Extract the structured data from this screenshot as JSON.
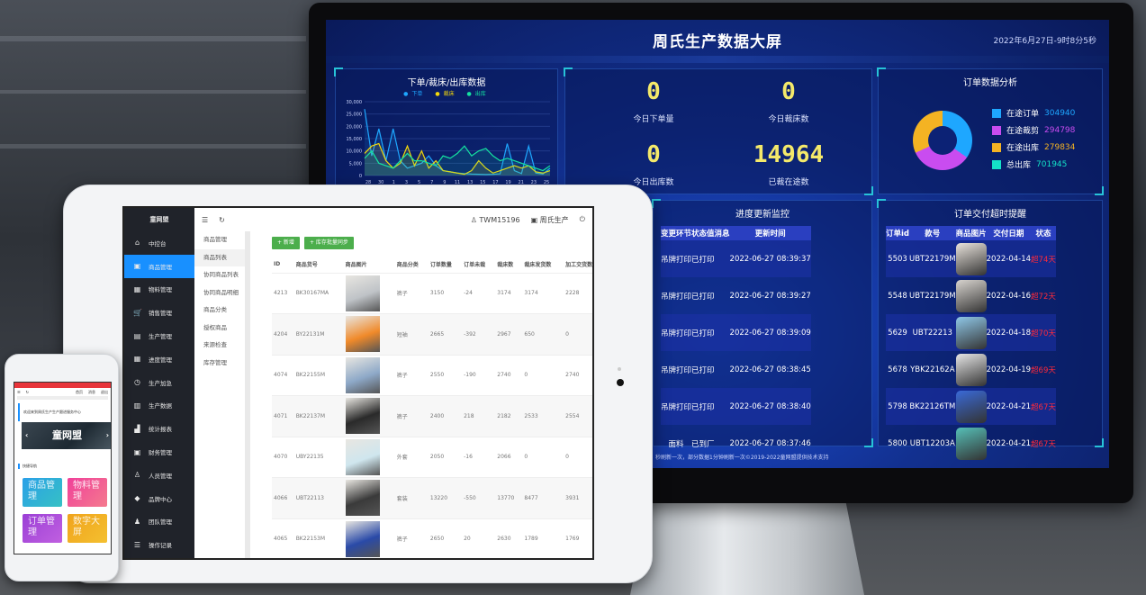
{
  "dashboard": {
    "title": "周氏生产数据大屏",
    "datetime": "2022年6月27日-9时8分5秒",
    "chart": {
      "title": "下单/裁床/出库数据",
      "legend": [
        "下单",
        "裁床",
        "出库"
      ],
      "colors": [
        "#1ea7ff",
        "#f5d90a",
        "#14e2a0"
      ],
      "y_ticks": [
        "30,000",
        "25,000",
        "20,000",
        "15,000",
        "10,000",
        "5,000",
        "0"
      ],
      "x_ticks": [
        "28",
        "30",
        "1",
        "3",
        "5",
        "7",
        "9",
        "11",
        "13",
        "15",
        "17",
        "19",
        "21",
        "23",
        "25"
      ],
      "series": [
        [
          27000,
          8000,
          19000,
          6000,
          19000,
          6000,
          3000,
          4000,
          5000,
          8000,
          4000,
          2000,
          1500,
          1000,
          800,
          600,
          500,
          400,
          500,
          700,
          13000,
          2000,
          800,
          12000,
          1000,
          600,
          3000
        ],
        [
          9000,
          12000,
          13000,
          6000,
          3000,
          5000,
          12000,
          4000,
          10000,
          3000,
          6000,
          2000,
          1500,
          1000,
          500,
          2000,
          6000,
          3000,
          1000,
          2000,
          3000,
          4000,
          3000,
          4000,
          1500,
          1000,
          2000
        ],
        [
          7000,
          10000,
          5000,
          4000,
          3000,
          6000,
          9000,
          6000,
          6000,
          5000,
          4000,
          8000,
          7000,
          9000,
          12000,
          8000,
          10000,
          11000,
          8000,
          6000,
          7000,
          6000,
          5000,
          4000,
          3000,
          2000,
          4000
        ]
      ]
    },
    "kpis": [
      {
        "value": "0",
        "label": "今日下单量"
      },
      {
        "value": "0",
        "label": "今日裁床数"
      },
      {
        "value": "0",
        "label": "今日出库数"
      },
      {
        "value": "14964",
        "label": "已裁在途数"
      }
    ],
    "order_analysis": {
      "title": "订单数据分析",
      "items": [
        {
          "label": "在途订单",
          "value": "304940",
          "color": "#1ea7ff"
        },
        {
          "label": "在途裁剪",
          "value": "294798",
          "color": "#c94cf0"
        },
        {
          "label": "在途出库",
          "value": "279834",
          "color": "#f4b323"
        },
        {
          "label": "总出库",
          "value": "701945",
          "color": "#14e2c8"
        }
      ]
    },
    "progress": {
      "title": "进度更新监控",
      "headers": [
        "变更环节",
        "状态值",
        "消息",
        "更新时间"
      ],
      "rows": [
        [
          "吊牌打印",
          "已打印",
          "",
          "2022-06-27 08:39:37"
        ],
        [
          "吊牌打印",
          "已打印",
          "",
          "2022-06-27 08:39:27"
        ],
        [
          "吊牌打印",
          "已打印",
          "",
          "2022-06-27 08:39:09"
        ],
        [
          "吊牌打印",
          "已打印",
          "",
          "2022-06-27 08:38:45"
        ],
        [
          "吊牌打印",
          "已打印",
          "",
          "2022-06-27 08:38:40"
        ],
        [
          "面料",
          "已到厂",
          "",
          "2022-06-27 08:37:46"
        ]
      ]
    },
    "timeout": {
      "title": "订单交付超时提醒",
      "headers": [
        "订单id",
        "款号",
        "商品图片",
        "交付日期",
        "状态"
      ],
      "rows": [
        [
          "5503",
          "UBT22179M",
          "2022-04-14",
          "超74天"
        ],
        [
          "5548",
          "UBT22179M",
          "2022-04-16",
          "超72天"
        ],
        [
          "5629",
          "UBT22213",
          "2022-04-18",
          "超70天"
        ],
        [
          "5678",
          "YBK22162A",
          "2022-04-19",
          "超69天"
        ],
        [
          "5798",
          "BK22126TM",
          "2022-04-21",
          "超67天"
        ],
        [
          "5800",
          "UBT12203A",
          "2022-04-21",
          "超67天"
        ]
      ]
    },
    "footer": "秒刷新一次，部分数据1分钟刷新一次©2019-2022童网盟提供技术支持"
  },
  "admin": {
    "brand": "童网盟",
    "sidebar": [
      "中控台",
      "商品管理",
      "物料管理",
      "销售管理",
      "生产管理",
      "进度管理",
      "生产加急",
      "生产数据",
      "统计报表",
      "财务管理",
      "人员管理",
      "品牌中心",
      "团队管理",
      "操作记录"
    ],
    "sidebar_icons": [
      "⌂",
      "▣",
      "▦",
      "🛒",
      "▤",
      "▦",
      "◷",
      "▥",
      "▟",
      "▣",
      "♙",
      "◆",
      "♟",
      "☰"
    ],
    "submenu_title": "商品管理",
    "submenu": [
      "商品列表",
      "协同商品列表",
      "协同商品明细",
      "商品分类",
      "授权商品",
      "来源检查",
      "库存管理"
    ],
    "user": "TWM15196",
    "shop": "周氏生产",
    "add_button": "+ 新增",
    "sync_button": "+ 库存批量同步",
    "headers": [
      "ID",
      "商品货号",
      "商品图片",
      "商品分类",
      "订单数量",
      "订单未裁",
      "裁床数",
      "裁床发货数",
      "加工交货数"
    ],
    "rows": [
      [
        "4213",
        "BK30167MA",
        "裤子",
        "3150",
        "-24",
        "3174",
        "3174",
        "2228"
      ],
      [
        "4204",
        "BY22131M",
        "短袖",
        "2665",
        "-392",
        "2967",
        "650",
        "0"
      ],
      [
        "4074",
        "BK22155M",
        "裤子",
        "2550",
        "-190",
        "2740",
        "0",
        "2740"
      ],
      [
        "4071",
        "BK22137M",
        "裤子",
        "2400",
        "218",
        "2182",
        "2533",
        "2554"
      ],
      [
        "4070",
        "UBY22135",
        "外套",
        "2050",
        "-16",
        "2066",
        "0",
        "0"
      ],
      [
        "4066",
        "UBT22113",
        "套装",
        "13220",
        "-550",
        "13770",
        "8477",
        "3931"
      ],
      [
        "4065",
        "BK22153M",
        "裤子",
        "2650",
        "20",
        "2630",
        "1789",
        "1769"
      ]
    ]
  },
  "mobile": {
    "nav": [
      "首页",
      "消息",
      "退出"
    ],
    "welcome": "欢迎来到周氏生产生产跟进服务中心",
    "banner": "童网盟",
    "quick_title": "快捷导航",
    "tiles": [
      "商品管理",
      "物料管理",
      "订单管理",
      "数字大屏"
    ]
  }
}
